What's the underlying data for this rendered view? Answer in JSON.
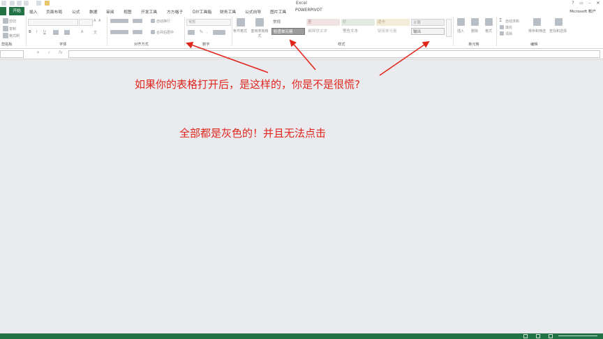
{
  "window": {
    "title": "Excel",
    "account": "Microsoft 帐户"
  },
  "tabs": [
    "开始",
    "插入",
    "页面布局",
    "公式",
    "数据",
    "审阅",
    "视图",
    "开发工具",
    "方方格子",
    "DIY工具箱",
    "财务工具",
    "公式向导",
    "图片工具",
    "POWERPIVOT"
  ],
  "ribbon": {
    "clipboard": {
      "cut": "剪切",
      "copy": "复制",
      "painter": "格式刷",
      "label": "剪贴板"
    },
    "font": {
      "label": "字体",
      "bold": "B",
      "italic": "I",
      "underline": "U"
    },
    "alignment": {
      "wrap": "自动换行",
      "merge": "合并后居中",
      "label": "对齐方式"
    },
    "number": {
      "format": "常规",
      "percent": "%",
      "comma": ",",
      "label": "数字"
    },
    "styles": {
      "conditional": "条件格式",
      "table": "套用表格格式",
      "cells": [
        "常规",
        "差",
        "好",
        "适中",
        "计算",
        "检查单元格",
        "解释性文本",
        "警告文本",
        "链接单元格",
        "输出"
      ],
      "label": "样式"
    },
    "cells_group": {
      "insert": "插入",
      "delete": "删除",
      "format": "格式",
      "label": "单元格"
    },
    "editing": {
      "autosum": "自动求和",
      "fill": "填充",
      "clear": "清除",
      "sort": "排序和筛选",
      "find": "查找和选择",
      "label": "编辑"
    }
  },
  "formula_bar": {
    "cancel": "✕",
    "enter": "✓",
    "fx": "fx"
  },
  "annotations": {
    "line1": "如果你的表格打开后，是这样的，你是不是很慌?",
    "line2": "全部都是灰色的！并且无法点击"
  },
  "colors": {
    "accent": "#217346",
    "annotation": "#e1261c"
  }
}
